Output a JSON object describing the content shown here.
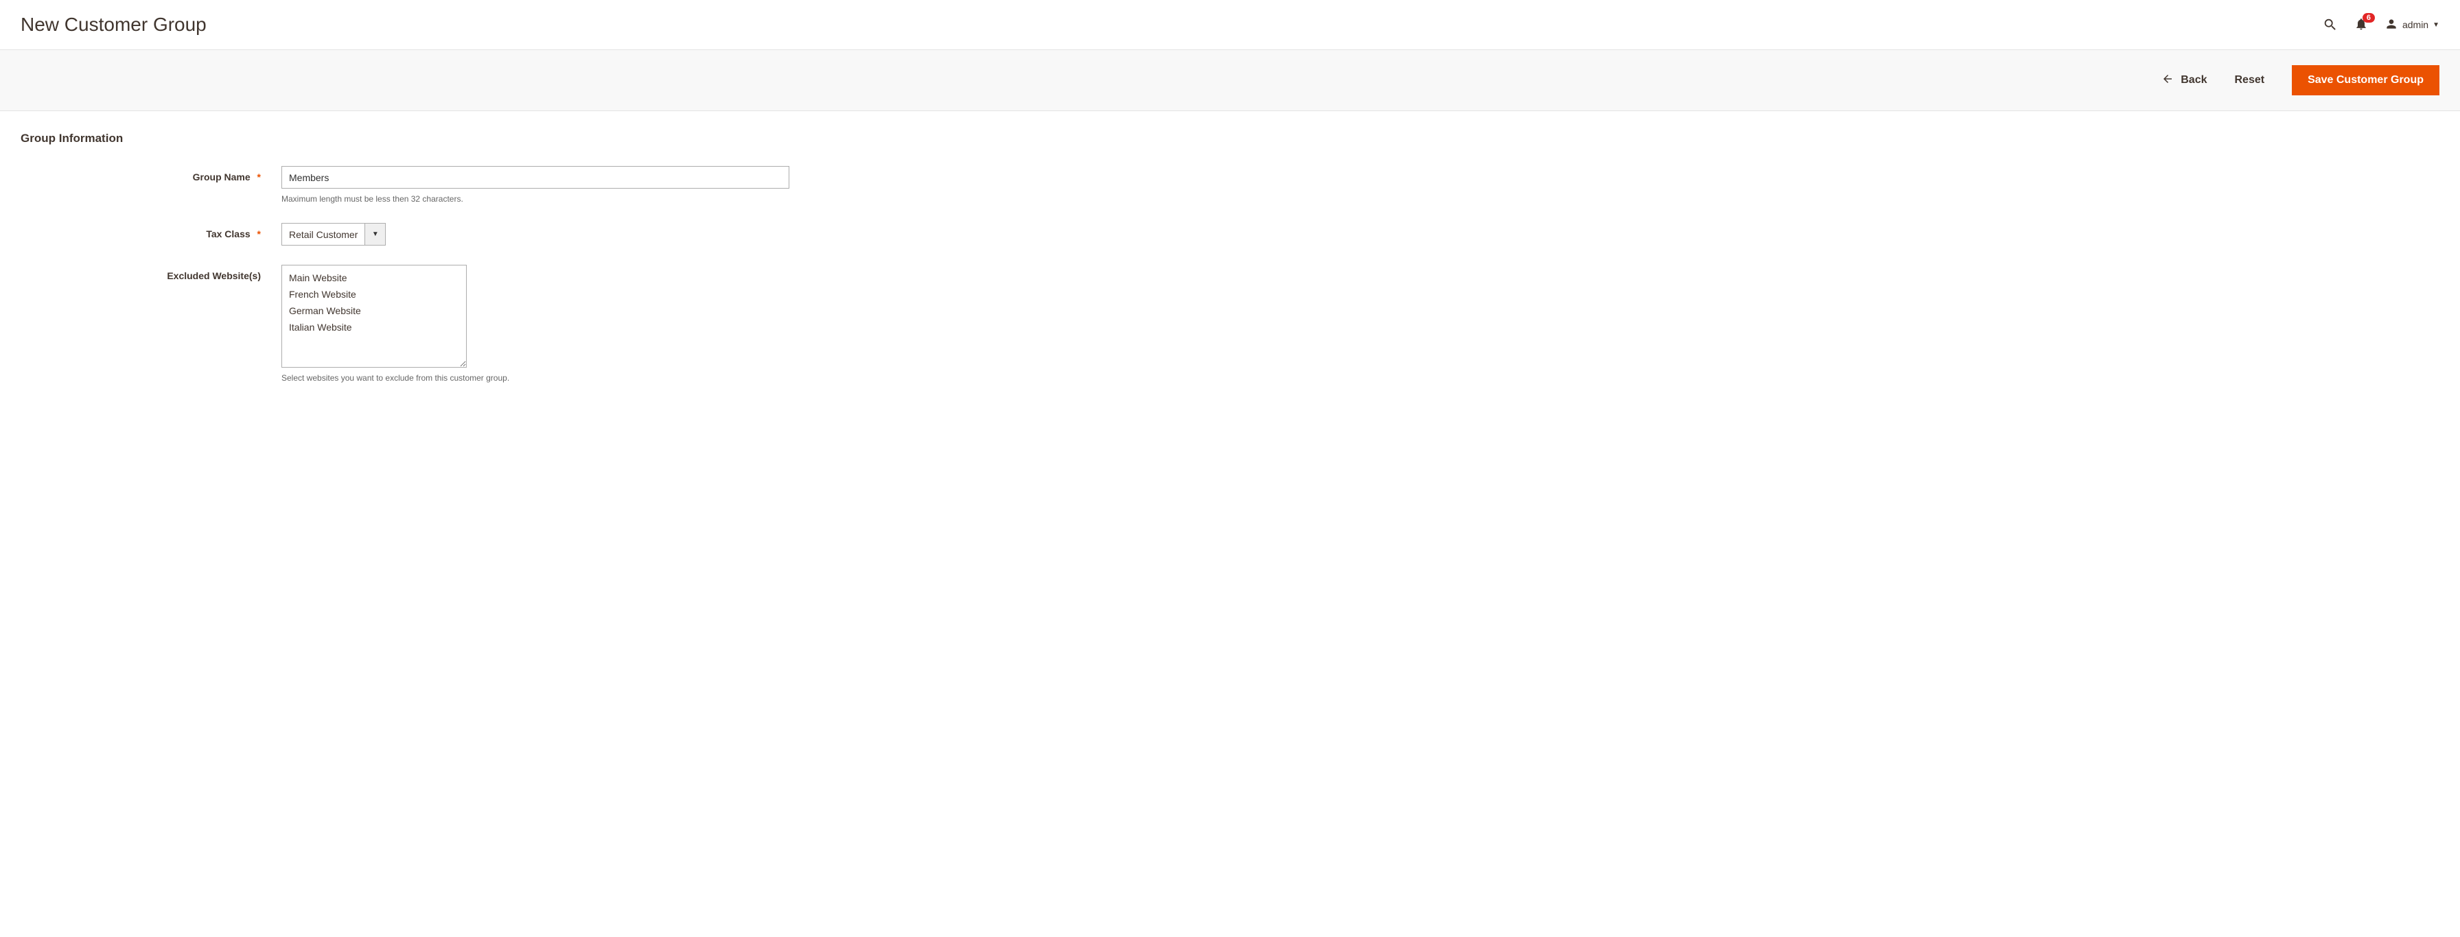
{
  "header": {
    "page_title": "New Customer Group",
    "user_name": "admin",
    "notification_count": "6"
  },
  "toolbar": {
    "back_label": "Back",
    "reset_label": "Reset",
    "save_label": "Save Customer Group"
  },
  "form": {
    "section_title": "Group Information",
    "group_name": {
      "label": "Group Name",
      "value": "Members",
      "helper": "Maximum length must be less then 32 characters."
    },
    "tax_class": {
      "label": "Tax Class",
      "value": "Retail Customer"
    },
    "excluded_websites": {
      "label": "Excluded Website(s)",
      "options": [
        "Main Website",
        "French Website",
        "German Website",
        "Italian Website"
      ],
      "helper": "Select websites you want to exclude from this customer group."
    }
  }
}
